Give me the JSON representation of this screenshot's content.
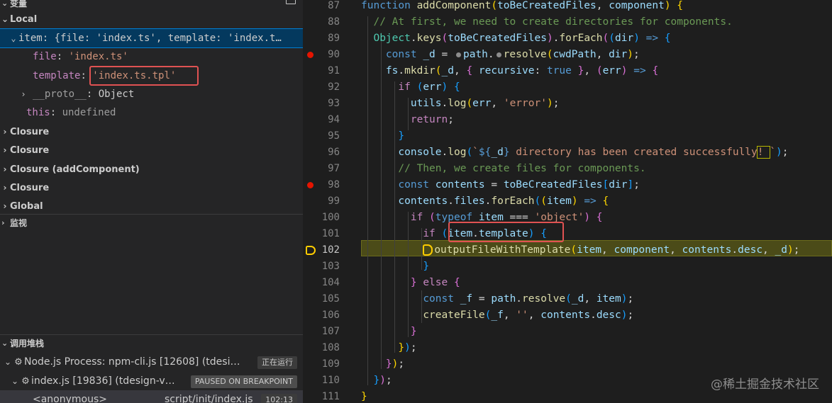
{
  "variables": {
    "section_title": "变量",
    "local_label": "Local",
    "item_row": "item: {file: 'index.ts', template: 'index.t…",
    "file_key": "file",
    "file_val": "'index.ts'",
    "template_key": "template",
    "template_val": "'index.ts.tpl'",
    "proto_key": "__proto__",
    "proto_val": "Object",
    "this_key": "this",
    "this_val": "undefined",
    "closures": [
      "Closure",
      "Closure",
      "Closure (addComponent)",
      "Closure",
      "Global"
    ]
  },
  "watch": {
    "section_title": "监视"
  },
  "callstack": {
    "section_title": "调用堆栈",
    "process_label": "Node.js Process: npm-cli.js [12608] (tdesi…",
    "process_badge": "正在运行",
    "thread_label": "index.js [19836] (tdesign-v…",
    "thread_badge": "PAUSED ON BREAKPOINT",
    "frame_name": "<anonymous>",
    "frame_file": "script/init/index.js",
    "frame_pos": "102:13"
  },
  "editor": {
    "line_numbers": [
      "87",
      "88",
      "89",
      "90",
      "91",
      "92",
      "93",
      "94",
      "95",
      "96",
      "97",
      "98",
      "99",
      "100",
      "101",
      "102",
      "103",
      "104",
      "105",
      "106",
      "107",
      "108",
      "109",
      "110",
      "111"
    ],
    "current_line": "102",
    "breakpoint_lines": [
      "90",
      "98"
    ]
  },
  "watermark": "@稀土掘金技术社区",
  "colors": {
    "breakpoint": "#e51400",
    "highlight_box": "#e05252",
    "current_line_bg": "#4b4b18"
  }
}
